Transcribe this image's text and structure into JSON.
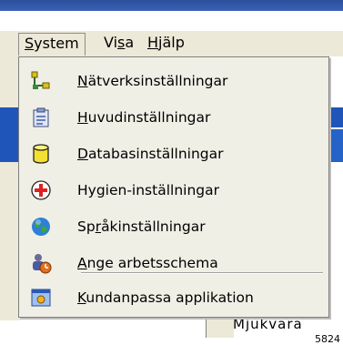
{
  "menubar": {
    "items": [
      {
        "label_pre": "",
        "label_key": "S",
        "label_post": "ystem"
      },
      {
        "label_pre": "Vi",
        "label_key": "s",
        "label_post": "a"
      },
      {
        "label_pre": "",
        "label_key": "H",
        "label_post": "jälp"
      }
    ]
  },
  "dropdown": {
    "items": [
      {
        "key": "N",
        "rest": "ätverksinställningar",
        "icon": "network-icon"
      },
      {
        "key": "H",
        "rest": "uvudinställningar",
        "icon": "clipboard-icon"
      },
      {
        "key": "D",
        "rest": "atabasinställningar",
        "icon": "database-icon"
      },
      {
        "pre": "Hy",
        "key": "g",
        "rest": "ien-inställningar",
        "icon": "hygiene-cross-icon"
      },
      {
        "pre": "Sp",
        "key": "r",
        "rest": "åkinställningar",
        "icon": "globe-icon"
      },
      {
        "key": "A",
        "rest": "nge arbetsschema",
        "icon": "schedule-icon"
      },
      {
        "key": "K",
        "rest": "undanpassa applikation",
        "icon": "customize-icon"
      }
    ]
  },
  "background": {
    "partial_text": "Mjukvara"
  },
  "figure_number": "5824"
}
